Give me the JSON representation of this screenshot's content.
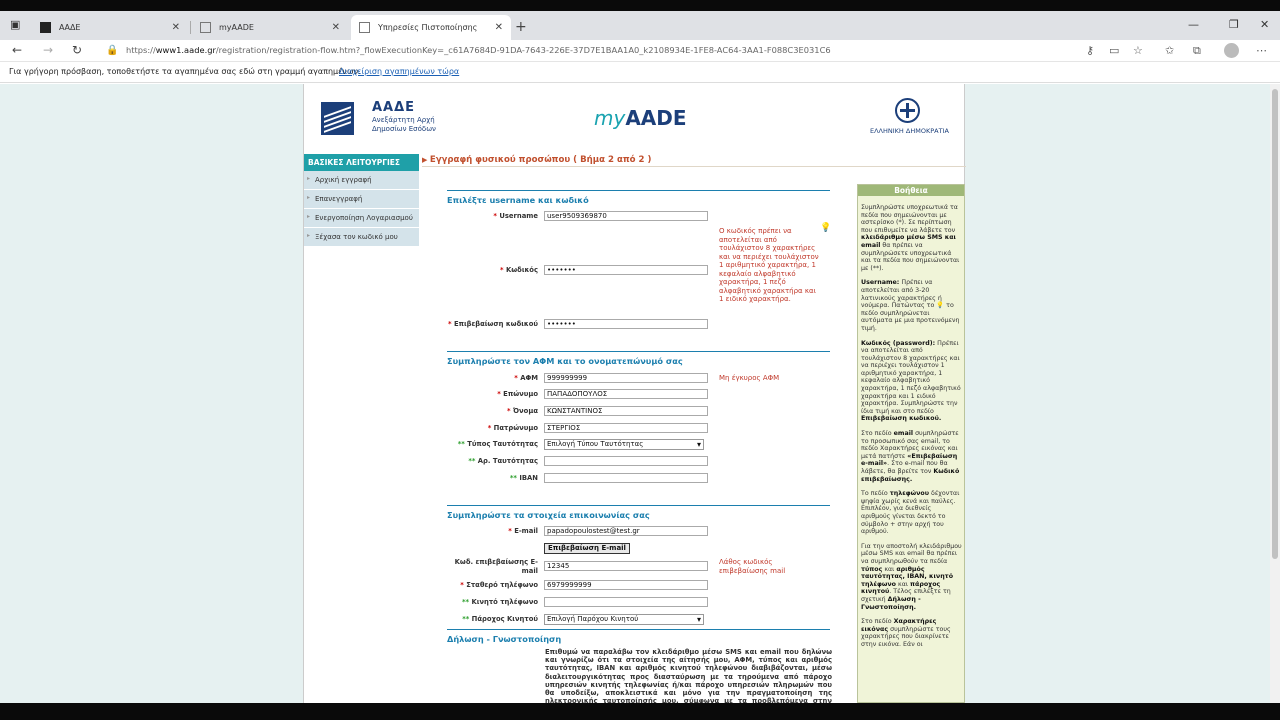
{
  "browser": {
    "tabs": [
      {
        "label": "ΑΑΔΕ"
      },
      {
        "label": "myAADE"
      },
      {
        "label": "Υπηρεσίες Πιστοποίησης"
      }
    ],
    "url_prefix": "https://",
    "url_host": "www1.aade.gr",
    "url_path": "/registration/registration-flow.htm?_flowExecutionKey=_c61A7684D-91DA-7643-226E-37D7E1BAA1A0_k2108934E-1FE8-AC64-3AA1-F088C3E031C6",
    "favorites_text": "Για γρήγορη πρόσβαση, τοποθετήστε τα αγαπημένα σας εδώ στη γραμμή αγαπημένων.",
    "favorites_link": "Διαχείριση αγαπημένων τώρα"
  },
  "header": {
    "org_title": "ΑΑΔΕ",
    "org_subtitle": "Ανεξάρτητη Αρχή Δημοσίων Εσόδων",
    "brand_my": "my",
    "brand_aade": "AADE",
    "gov_text": "ΕΛΛΗΝΙΚΗ ΔΗΜΟΚΡΑΤΙΑ"
  },
  "sidenav": {
    "heading": "ΒΑΣΙΚΕΣ ΛΕΙΤΟΥΡΓΙΕΣ",
    "items": [
      "Αρχική εγγραφή",
      "Επανεγγραφή",
      "Ενεργοποίηση Λογαριασμού",
      "Ξέχασα τον κωδικό μου"
    ]
  },
  "step_title": "Εγγραφή φυσικού προσώπου ( Βήμα 2 από 2 )",
  "sections": {
    "credentials": "Επιλέξτε username και κωδικό",
    "identity": "Συμπληρώστε τον ΑΦΜ και το ονοματεπώνυμό σας",
    "contact": "Συμπληρώστε τα στοιχεία επικοινωνίας σας",
    "declaration": "Δήλωση - Γνωστοποίηση"
  },
  "fields": {
    "username_label": "Username",
    "username_value": "user9509369870",
    "password_label": "Κωδικός",
    "password_value": "•••••••",
    "password_confirm_label": "Επιβεβαίωση κωδικού",
    "password_confirm_value": "•••••••",
    "afm_label": "ΑΦΜ",
    "afm_value": "999999999",
    "surname_label": "Επώνυμο",
    "surname_value": "ΠΑΠΑΔΟΠΟΥΛΟΣ",
    "name_label": "Όνομα",
    "name_value": "ΚΩΝΣΤΑΝΤΙΝΟΣ",
    "father_label": "Πατρώνυμο",
    "father_value": "ΣΤΕΡΓΙΟΣ",
    "idtype_label": "Τύπος Ταυτότητας",
    "idtype_value": "Επιλογή Τύπου Ταυτότητας",
    "idnum_label": "Αρ. Ταυτότητας",
    "idnum_value": "",
    "iban_label": "IBAN",
    "iban_value": "",
    "email_label": "E-mail",
    "email_value": "papadopoulostest@test.gr",
    "email_button": "Επιβεβαίωση E-mail",
    "email_code_label": "Κωδ. επιβεβαίωσης E-mail",
    "email_code_value": "12345",
    "phone_label": "Σταθερό τηλέφωνο",
    "phone_value": "6979999999",
    "mobile_label": "Κινητό τηλέφωνο",
    "mobile_value": "",
    "provider_label": "Πάροχος Κινητού",
    "provider_value": "Επιλογή Παρόχου Κινητού"
  },
  "errors": {
    "password": "Ο κωδικός πρέπει να αποτελείται από τουλάχιστον 8 χαρακτήρες και να περιέχει τουλάχιστον 1 αριθμητικό χαρακτήρα, 1 κεφαλαίο αλφαβητικό χαρακτήρα, 1 πεζό αλφαβητικό χαρακτήρα και 1 ειδικό χαρακτήρα.",
    "afm": "Μη έγκυρος ΑΦΜ",
    "email_code": "Λάθος κωδικός επιβεβαίωσης mail"
  },
  "declaration_text": "Επιθυμώ να παραλάβω τον κλειδάριθμο μέσω SMS και email που δηλώνω και γνωρίζω ότι τα στοιχεία της αίτησής μου, ΑΦΜ, τύπος και αριθμός ταυτότητας, IBAN και αριθμός κινητού τηλεφώνου διαβιβάζονται, μέσω διαλειτουργικότητας προς διασταύρωση με τα τηρούμενα από πάροχο υπηρεσιών κινητής τηλεφωνίας ή/και πάροχο υπηρεσιών πληρωμών που θα υποδείξω, αποκλειστικά και μόνο για την πραγματοποίηση της ηλεκτρονικής ταυτοποίησής μου, σύμφωνα με τα προβλεπόμενα στην απόφαση",
  "help": {
    "heading": "Βοήθεια",
    "p1a": "Συμπληρώστε υποχρεωτικά τα πεδία που σημειώνονται με αστερίσκο (*). Σε περίπτωση που επιθυμείτε να λάβετε τον ",
    "p1b": "κλειδάριθμο μέσω SMS και email",
    "p1c": " θα πρέπει να συμπληρώσετε υποχρεωτικά και τα πεδία που σημειώνονται με (**).",
    "p2a": "Username:",
    "p2b": " Πρέπει να αποτελείται από 3-20 λατινικούς χαρακτήρες ή νούμερα. Πατώντας το ",
    "p2c": " το πεδίο συμπληρώνεται αυτόματα με μια προτεινόμενη τιμή.",
    "p3a": "Κωδικός (password):",
    "p3b": " Πρέπει να αποτελείται από τουλάχιστον 8 χαρακτήρες και να περιέχει τουλάχιστον 1 αριθμητικό χαρακτήρα, 1 κεφαλαίο αλφαβητικό χαρακτήρα, 1 πεζό αλφαβητικό χαρακτήρα και 1 ειδικό χαρακτήρα. Συμπληρώστε την ίδια τιμή και στο πεδίο ",
    "p3c": "Επιβεβαίωση κωδικού.",
    "p4a": "Στο πεδίο ",
    "p4b": "email",
    "p4c": " συμπληρώστε το προσωπικό σας email, το πεδίο Χαρακτήρες εικόνας και μετά πατήστε ",
    "p4d": "«Επιβεβαίωση e-mail»",
    "p4e": ". Στο e-mail που θα λάβετε, θα βρείτε τον ",
    "p4f": "Κωδικό επιβεβαίωσης.",
    "p5a": "Το πεδίο ",
    "p5b": "τηλεφώνου",
    "p5c": " δέχονται ψηφία χωρίς κενά και παύλες. Επιπλέον, για διεθνείς αριθμούς γίνεται δεκτό το σύμβολο + στην αρχή του αριθμού.",
    "p6a": "Για την αποστολή κλειδάριθμου μέσω SMS και email θα πρέπει να συμπληρωθούν τα πεδία ",
    "p6b": "τύπος",
    "p6c": " και ",
    "p6d": "αριθμός ταυτότητας, IBAN, κινητό τηλέφωνο",
    "p6e": " και ",
    "p6f": "πάροχος κινητού",
    "p6g": ". Τέλος επιλέξτε τη σχετική ",
    "p6h": "Δήλωση - Γνωστοποίηση.",
    "p7a": "Στο πεδίο ",
    "p7b": "Χαρακτήρες εικόνας",
    "p7c": " συμπληρώστε τους χαρακτήρες που διακρίνετε στην εικόνα. Εάν οι"
  }
}
